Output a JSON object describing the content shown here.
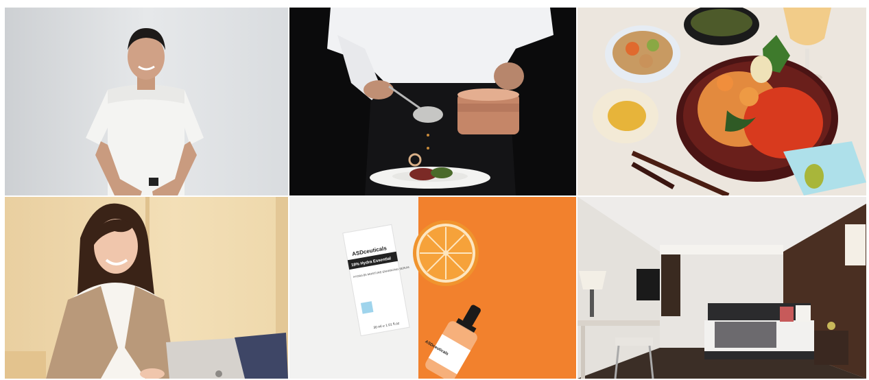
{
  "gallery": {
    "tiles": [
      {
        "id": "portrait-man"
      },
      {
        "id": "chef-plating"
      },
      {
        "id": "seafood-donburi"
      },
      {
        "id": "woman-laptop"
      },
      {
        "id": "serum-product",
        "box_brand": "ASDceuticals",
        "box_band": "19% Hydra Essential",
        "box_desc": "HYDRA B5 MOISTURE ENHANCING SERUM",
        "box_volume": "30 ml ℮ 1.01 fl.oz",
        "bottle_brand": "ASDceuticals"
      },
      {
        "id": "hotel-bedroom"
      }
    ]
  }
}
